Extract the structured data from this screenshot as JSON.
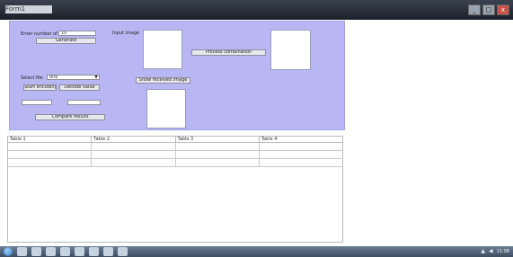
{
  "window": {
    "title": "Form1",
    "controls": {
      "minimize": "_",
      "maximize": "□",
      "close": "x"
    }
  },
  "panel": {
    "top_label": "Enter number of bits",
    "top_field_value": "10",
    "top_button": "Generate",
    "image_label": "Input image",
    "right_button": "Process combination",
    "combo_label": "Select file",
    "combo_value": "bits",
    "left_button_1": "Start encoding",
    "left_button_2": "Decode value",
    "middle_button": "Show received image",
    "bottom_button": "Compare results"
  },
  "table": {
    "columns": [
      "Table 1",
      "Table 2",
      "Table 3",
      "Table 4"
    ],
    "rows": [
      [
        "",
        "",
        "",
        ""
      ],
      [
        "",
        "",
        "",
        ""
      ],
      [
        "",
        "",
        "",
        ""
      ]
    ]
  },
  "taskbar": {
    "icons": [
      "start-orb",
      "ie-icon",
      "folder-icon",
      "media-icon",
      "app-icon",
      "browser-icon",
      "tool-icon",
      "editor-icon",
      "window-icon"
    ],
    "tray": [
      "network-icon",
      "volume-icon"
    ],
    "clock": "11:08"
  }
}
